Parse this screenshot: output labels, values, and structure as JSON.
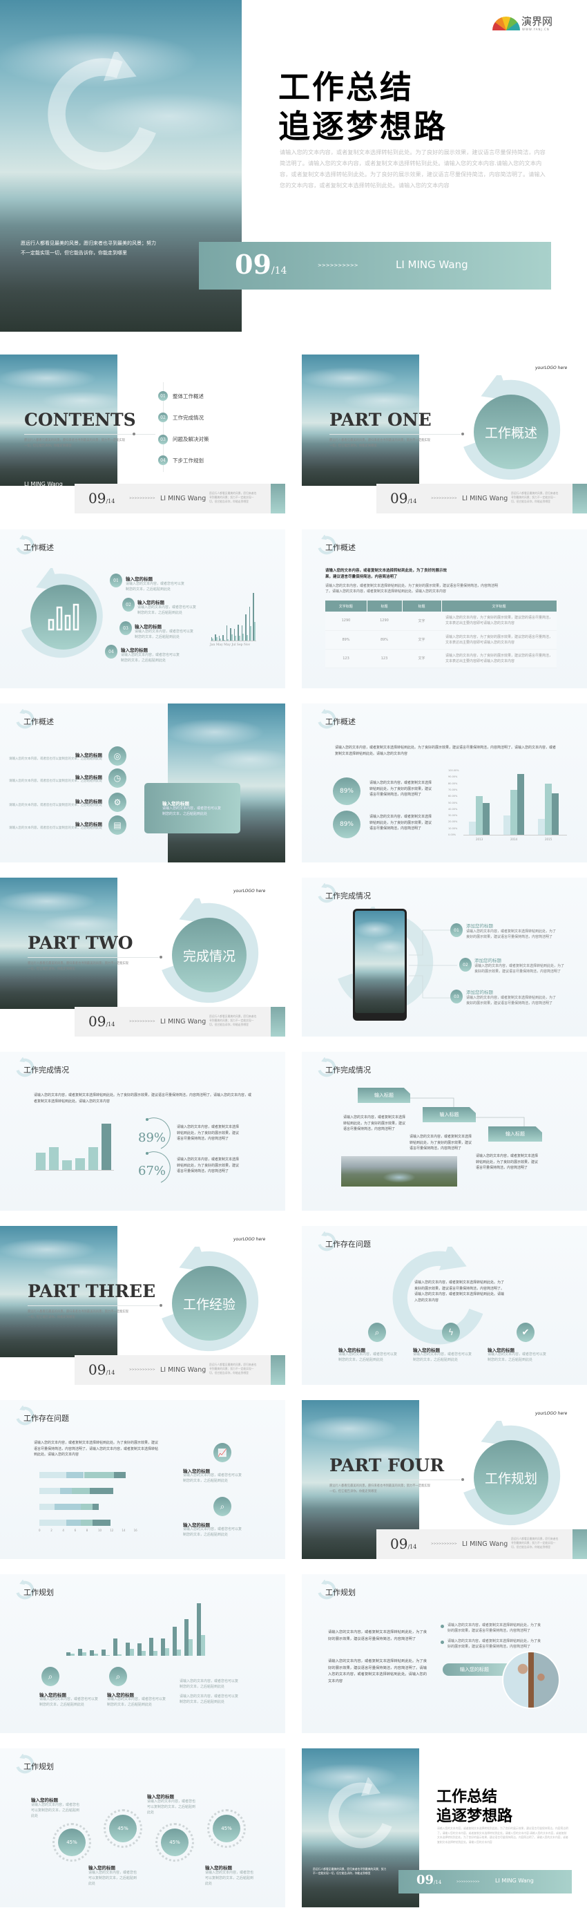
{
  "common": {
    "item_title": "输入您的标题",
    "desc2": "请输入您的文本内容，或者您也可以复制您的文本，之后粘贴到此处",
    "desc_para": "请输入您的文本内容，或者复制文本选择转帖到此处，为了良好的展示效果，建议语言尽量保持简洁，内容简洁明了",
    "desc_long": "请输入您的文本内容，或者复制文本选择转帖到此处。为了良好的展示效果，建议语言尽量保持简洁，内容简洁明了。请输入您的文本内容，或者复制文本选择转帖到此处。请输入您的文本内容",
    "quote": "愿远行人都看见最美的风景，愿归来者也寻到最美的风景；努力不一定能实现一切，但它能告诉你，你能走到哪里",
    "page": "09",
    "total": "/14",
    "arrows": ">>>>>>>>>>",
    "name": "LI MING Wang",
    "logo": "yourLOGO here",
    "add_title": "添加您的标题",
    "input_title": "输入标题",
    "colors": {
      "accent_dark": "#74a09e",
      "accent_light": "#a8d2cc",
      "ring": "#d5e8ec"
    }
  },
  "hero": {
    "brand": "演界网",
    "brand_url": "WWW.YANJ.CN",
    "title_1": "工作总结",
    "title_2": "追逐梦想路",
    "body": "请输入您的文本内容，或者复制文本选择转帖到此处。为了良好的展示效果，建议语言尽量保持简洁，内容简洁明了。请输入您的文本内容，或者复制文本选择转帖到此处。请输入您的文本内容.请输入您的文本内容，或者复制文本选择转帖到此处。为了良好的展示效果，建议语言尽量保持简洁，内容简洁明了。请输入您的文本内容，或者复制文本选择转帖到此处。请输入您的文本内容"
  },
  "contents": {
    "title": "CONTENTS",
    "items": [
      {
        "num": "01",
        "label": "整体工作概述"
      },
      {
        "num": "02",
        "label": "工作完成情况"
      },
      {
        "num": "03",
        "label": "问题及解决对策"
      },
      {
        "num": "04",
        "label": "下步工作规划"
      }
    ]
  },
  "sections": [
    {
      "part": "PART ONE",
      "circle": "工作概述"
    },
    {
      "part": "PART TWO",
      "circle": "完成情况"
    },
    {
      "part": "PART THREE",
      "circle": "工作经验"
    },
    {
      "part": "PART FOUR",
      "circle": "工作规划"
    }
  ],
  "headers": {
    "overview": "工作概述",
    "completion": "工作完成情况",
    "problems": "工作存在问题",
    "plan": "工作规划"
  },
  "overview1": {
    "items": [
      "01",
      "02",
      "03",
      "04"
    ],
    "chart_labels": "Jan May May Jul Sep Nov"
  },
  "bars12": {
    "dark": [
      5,
      10,
      8,
      9,
      24,
      19,
      18,
      25,
      24,
      41,
      52,
      74
    ],
    "light": [
      3,
      5,
      3,
      1,
      2,
      10,
      7,
      7,
      11,
      9,
      23,
      29
    ]
  },
  "overview2": {
    "lead": "请输入您的文本内容，或者复制文本选择转帖到此处，为了良好的展示效果，建议语言尽量保持简洁，内容简洁明了",
    "table": {
      "headers": [
        "文字标题",
        "标题",
        "标题",
        "文字标题"
      ],
      "rows": [
        [
          "1290",
          "1290",
          "文字",
          "请输入您的文本内容，为了良好的展示效果，建议您的语言尽量简洁，文本表达出主要内容即可请输入您的文本内容"
        ],
        [
          "89%",
          "89%",
          "文字",
          "请输入您的文本内容，为了良好的展示效果，建议您的语言尽量简洁，文本表达出主要内容即可请输入您的文本内容"
        ],
        [
          "123",
          "123",
          "文字",
          "请输入您的文本内容，为了良好的展示效果，建议您的语言尽量简洁，文本表达出主要内容即可请输入您的文本内容"
        ]
      ]
    }
  },
  "overview4": {
    "pct_1": "89%",
    "pct_2": "89%",
    "chart": {
      "type": "bar",
      "categories": [
        "2013",
        "2014",
        "2015"
      ],
      "series": [
        {
          "values": [
            20,
            30,
            25
          ]
        },
        {
          "values": [
            60,
            70,
            80
          ]
        },
        {
          "values": [
            50,
            95,
            65
          ]
        }
      ],
      "ylim": [
        0,
        100
      ],
      "yticks": [
        "0.00%",
        "10.00%",
        "20.00%",
        "30.00%",
        "40.00%",
        "50.00%",
        "60.00%",
        "70.00%",
        "80.00%",
        "90.00%",
        "100.00%"
      ]
    }
  },
  "completion2": {
    "pct_1": "89%",
    "pct_2": "67%",
    "bars": [
      21,
      28,
      12,
      14,
      28,
      57
    ]
  },
  "problems2": {
    "stacked": [
      [
        4.5,
        3,
        5,
        2
      ],
      [
        3.5,
        2,
        3,
        4
      ],
      [
        2.5,
        4.5,
        2,
        1
      ],
      [
        4.5,
        2.5,
        2,
        3
      ]
    ],
    "xticks": [
      "0",
      "2",
      "4",
      "6",
      "8",
      "10",
      "12",
      "14",
      "16"
    ]
  },
  "plan3": {
    "pill": "输入您的标题"
  },
  "plan4": {
    "pcts": [
      "45%",
      "45%",
      "45%",
      "45%"
    ]
  },
  "closing": {
    "title_1": "工作总结",
    "title_2": "追逐梦想路"
  }
}
